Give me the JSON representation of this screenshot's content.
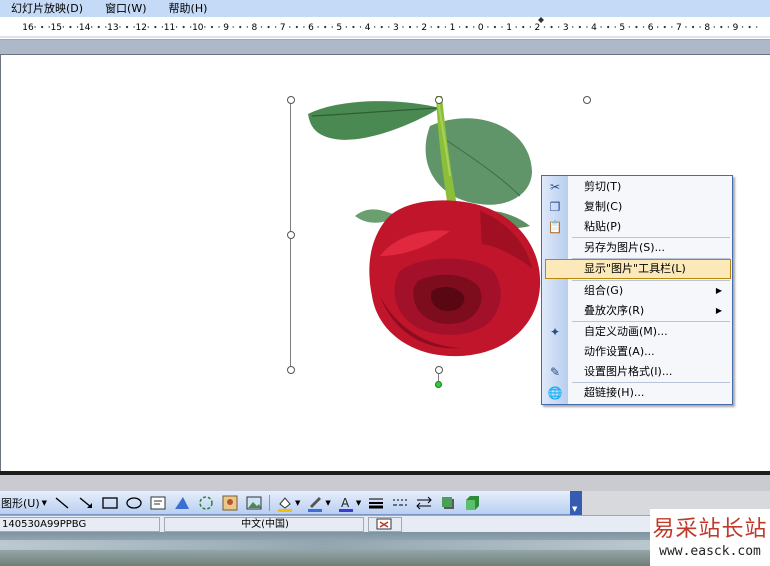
{
  "menubar": {
    "items": [
      "幻灯片放映(D)",
      "窗口(W)",
      "帮助(H)"
    ]
  },
  "ruler": {
    "labels": [
      "16",
      "15",
      "14",
      "13",
      "12",
      "11",
      "10",
      "9",
      "8",
      "7",
      "6",
      "5",
      "4",
      "3",
      "2",
      "1",
      "0",
      "1",
      "2",
      "3",
      "4",
      "5",
      "6",
      "7",
      "8",
      "9"
    ]
  },
  "context_menu": {
    "items": [
      {
        "label": "剪切(T)",
        "icon": "scissors-icon"
      },
      {
        "label": "复制(C)",
        "icon": "copy-icon"
      },
      {
        "label": "粘贴(P)",
        "icon": "paste-icon"
      },
      {
        "label": "另存为图片(S)...",
        "icon": ""
      },
      {
        "label": "显示\"图片\"工具栏(L)",
        "icon": "",
        "highlighted": true
      },
      {
        "label": "组合(G)",
        "icon": "",
        "submenu": true
      },
      {
        "label": "叠放次序(R)",
        "icon": "",
        "submenu": true
      },
      {
        "label": "自定义动画(M)...",
        "icon": "custom-animation-icon"
      },
      {
        "label": "动作设置(A)...",
        "icon": ""
      },
      {
        "label": "设置图片格式(I)...",
        "icon": "format-picture-icon"
      },
      {
        "label": "超链接(H)...",
        "icon": "hyperlink-icon"
      }
    ]
  },
  "drawing_toolbar": {
    "shapes_label": "图形(U)"
  },
  "statusbar": {
    "left_text": "140530A99PPBG",
    "language": "中文(中国)"
  },
  "watermark": {
    "title": "易采站长站",
    "url": "www.easck.com"
  },
  "colors": {
    "menu_bar": "#c4daf7",
    "menu_highlight": "#fbe9b9",
    "rose_red": "#c0152b",
    "leaf_green": "#4a8a52"
  }
}
